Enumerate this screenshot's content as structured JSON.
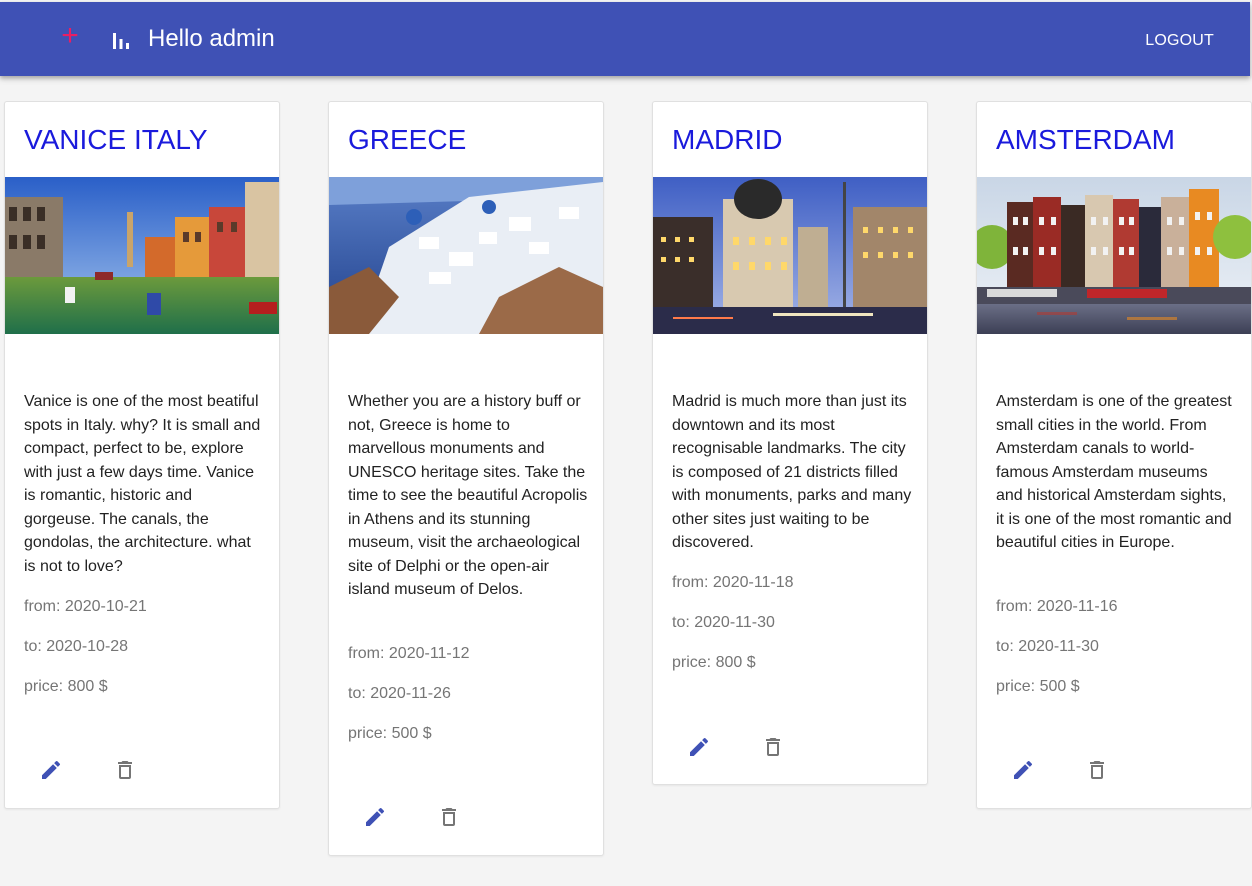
{
  "header": {
    "greeting": "Hello admin",
    "logout_label": "LOGOUT",
    "icons": [
      "add-icon",
      "bar-chart-icon"
    ]
  },
  "colors": {
    "appbar": "#3f51b5",
    "accent": "#e91e63",
    "title": "#1a1adc",
    "edit_icon": "#3f51b5",
    "delete_icon": "#757575"
  },
  "trips": [
    {
      "title": "VANICE ITALY",
      "description": "Vanice is one of the most beatiful spots in Italy. why? It is small and compact, perfect to be, explore with just a few days time. Vanice is romantic, historic and gorgeuse. The canals, the gondolas, the architecture. what is not to love?",
      "from": "from: 2020-10-21",
      "to": "to: 2020-10-28",
      "price": "price: 800 $"
    },
    {
      "title": "GREECE",
      "description": "Whether you are a history buff or not, Greece is home to marvellous monuments and UNESCO heritage sites. Take the time to see the beautiful Acropolis in Athens and its stunning museum, visit the archaeological site of Delphi or the open-air island museum of Delos.",
      "from": "from: 2020-11-12",
      "to": "to: 2020-11-26",
      "price": "price: 500 $"
    },
    {
      "title": "MADRID",
      "description": "Madrid is much more than just its downtown and its most recognisable landmarks. The city is composed of 21 districts filled with monuments, parks and many other sites just waiting to be discovered.",
      "from": "from: 2020-11-18",
      "to": "to: 2020-11-30",
      "price": "price: 800 $"
    },
    {
      "title": "AMSTERDAM",
      "description": "Amsterdam is one of the greatest small cities in the world. From Amsterdam canals to world-famous Amsterdam museums and historical Amsterdam sights, it is one of the most romantic and beautiful cities in Europe.",
      "from": "from: 2020-11-16",
      "to": "to: 2020-11-30",
      "price": "price: 500 $"
    }
  ]
}
